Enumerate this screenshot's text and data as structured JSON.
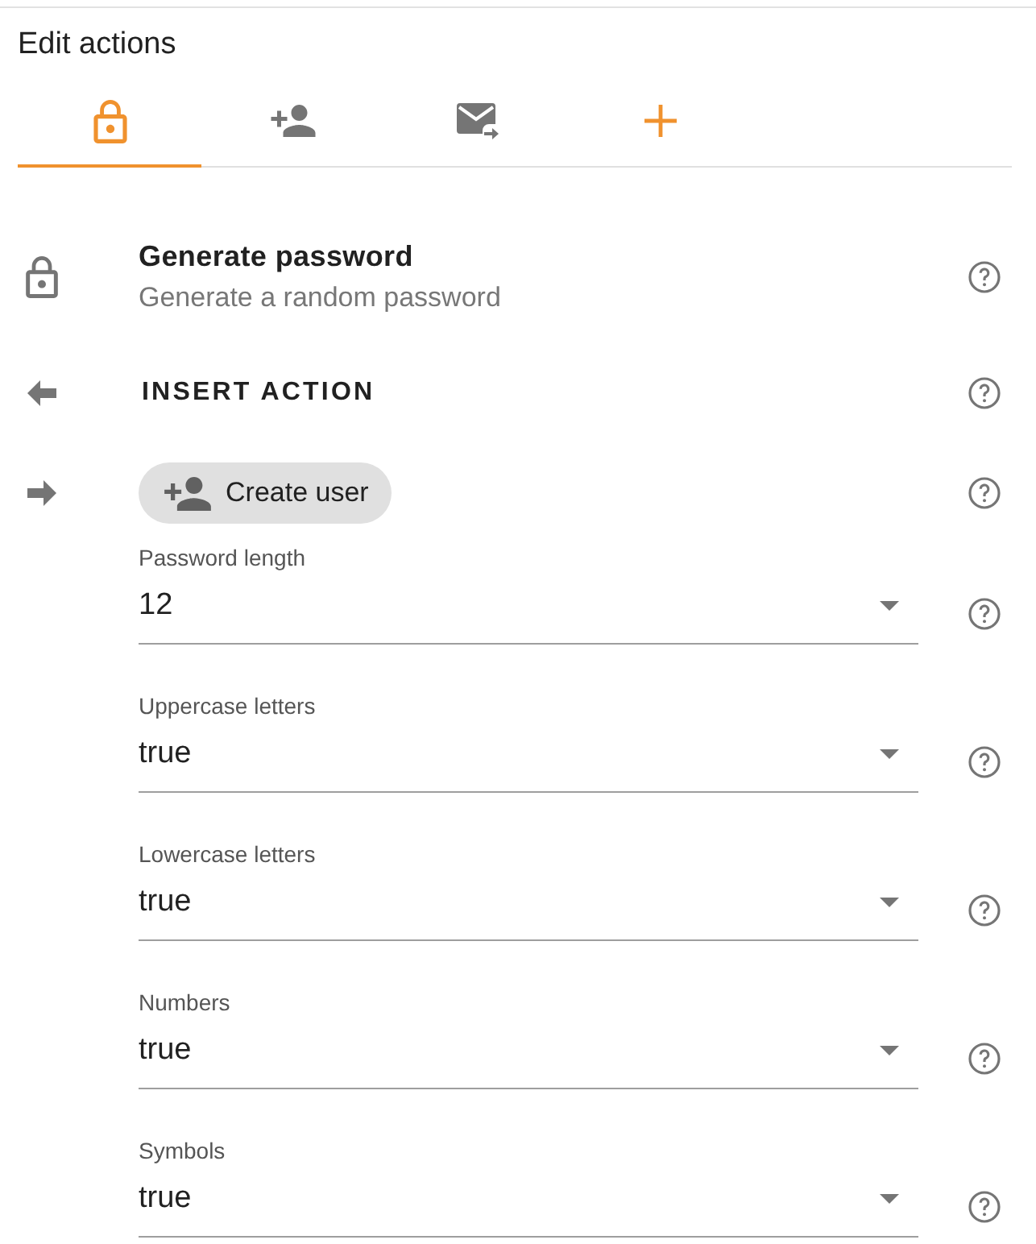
{
  "panel": {
    "title": "Edit actions"
  },
  "tabs": [
    {
      "kind": "lock",
      "selected": true
    },
    {
      "kind": "person-add",
      "selected": false
    },
    {
      "kind": "mail-forward",
      "selected": false
    },
    {
      "kind": "add",
      "selected": false
    }
  ],
  "action": {
    "title": "Generate password",
    "description": "Generate a random password"
  },
  "insert": {
    "label": "INSERT ACTION"
  },
  "next": {
    "chip": "Create user"
  },
  "fields": [
    {
      "label": "Password length",
      "value": "12"
    },
    {
      "label": "Uppercase letters",
      "value": "true"
    },
    {
      "label": "Lowercase letters",
      "value": "true"
    },
    {
      "label": "Numbers",
      "value": "true"
    },
    {
      "label": "Symbols",
      "value": "true"
    }
  ]
}
